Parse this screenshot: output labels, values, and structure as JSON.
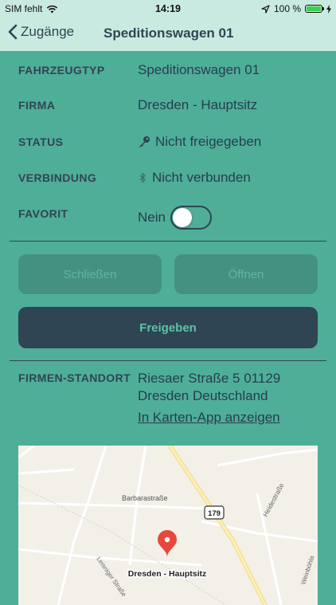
{
  "status_bar": {
    "carrier": "SIM fehlt",
    "time": "14:19",
    "battery": "100 %",
    "battery_level": 1.0
  },
  "nav": {
    "back_label": "Zugänge",
    "title": "Speditionswagen 01"
  },
  "details": {
    "fahrzeugtyp": {
      "label": "FAHRZEUGTYP",
      "value": "Speditionswagen 01"
    },
    "firma": {
      "label": "FIRMA",
      "value": "Dresden - Hauptsitz"
    },
    "status": {
      "label": "STATUS",
      "value": "Nicht freigegeben"
    },
    "verbindung": {
      "label": "VERBINDUNG",
      "value": "Nicht verbunden"
    },
    "favorit": {
      "label": "FAVORIT",
      "value": "Nein",
      "on": false
    }
  },
  "buttons": {
    "close": "Schließen",
    "open": "Öffnen",
    "release": "Freigeben"
  },
  "location": {
    "label": "FIRMEN-STANDORT",
    "address_line1": "Riesaer Straße 5 01129",
    "address_line2": "Dresden Deutschland",
    "link": "In Karten-App anzeigen"
  },
  "map": {
    "street1": "Barbarastraße",
    "street2": "Heidestraße",
    "street3": "Weinböhla",
    "street4": "Leisniger Straße",
    "route": "179",
    "pin_label": "Dresden - Hauptsitz",
    "pin_color": "#e8473e"
  },
  "colors": {
    "background": "#4fae98",
    "header": "#c9eae0",
    "dark": "#2f4553",
    "accent": "#5cc4a8"
  }
}
